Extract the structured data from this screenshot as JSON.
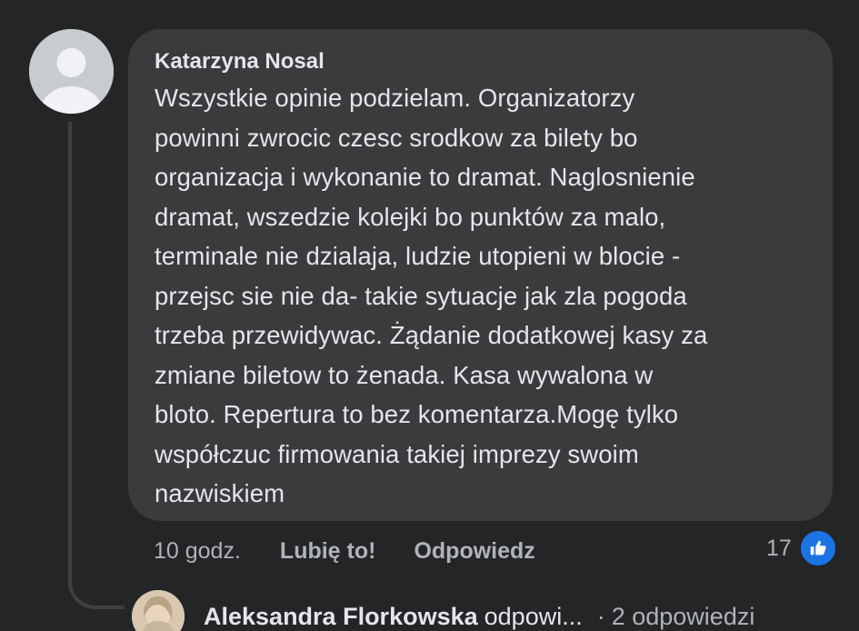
{
  "comment": {
    "author": "Katarzyna Nosal",
    "text": "Wszystkie opinie podzielam. Organizatorzy\npowinni zwrocic czesc srodkow za bilety bo\norganizacja i wykonanie to dramat. Naglosnienie\ndramat, wszedzie kolejki bo punktów za malo,\nterminale nie dzialaja, ludzie utopieni w blocie -\nprzejsc sie nie da- takie sytuacje jak zla pogoda\ntrzeba przewidywac. Żądanie dodatkowej kasy za\nzmiane biletow to żenada. Kasa wywalona w\nbloto. Repertura to bez komentarza.Mogę tylko\nwspółczuc firmowania takiej imprezy swoim\nnazwiskiem",
    "timestamp": "10 godz.",
    "like_label": "Lubię to!",
    "reply_label": "Odpowiedz",
    "reaction_count": "17",
    "reaction_icon": "thumbs-up-icon",
    "reaction_color": "#1b74e4"
  },
  "reply_preview": {
    "author": "Aleksandra Florkowska",
    "verb": "odpowi...",
    "separator": "·",
    "count_label": "2 odpowiedzi"
  },
  "colors": {
    "background": "#242526",
    "bubble": "#3a3b3c",
    "primary_text": "#e4e6eb",
    "secondary_text": "#b0b3b8"
  }
}
